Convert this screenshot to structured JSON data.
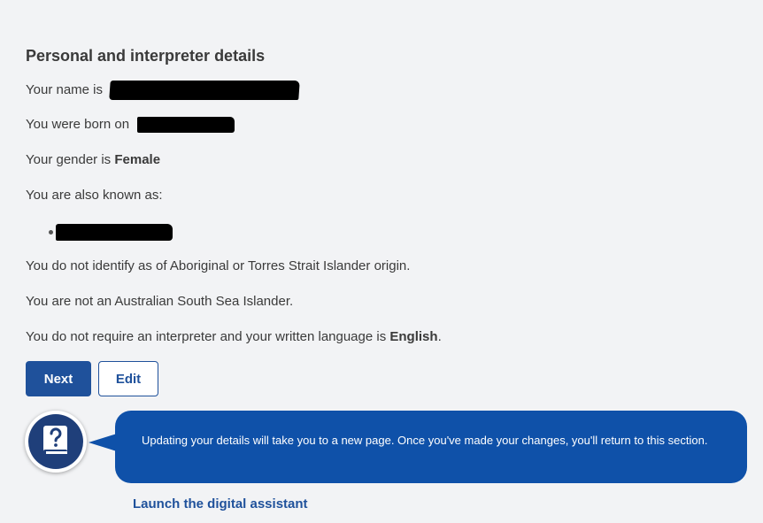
{
  "section": {
    "title": "Personal and interpreter details"
  },
  "details": {
    "name_prefix": "Your name is",
    "dob_prefix": "You were born on",
    "gender_prefix": "Your gender is ",
    "gender_value": "Female",
    "aka_label": "You are also known as:",
    "aboriginal_status": "You do not identify as of Aboriginal or Torres Strait Islander origin.",
    "south_sea_status": "You are not an Australian South Sea Islander.",
    "interpreter_prefix": "You do not require an interpreter and your written language is ",
    "language_value": "English",
    "interpreter_suffix": "."
  },
  "buttons": {
    "next_label": "Next",
    "edit_label": "Edit"
  },
  "assistant": {
    "message": "Updating your details will take you to a new page. Once you've made your changes, you'll return to this section.",
    "launch_label": "Launch the digital assistant",
    "icon": "help-book-icon"
  },
  "colors": {
    "primary": "#1f519b",
    "bubble": "#0f51a9",
    "background": "#f2f3f5",
    "text": "#3a3a3a"
  }
}
